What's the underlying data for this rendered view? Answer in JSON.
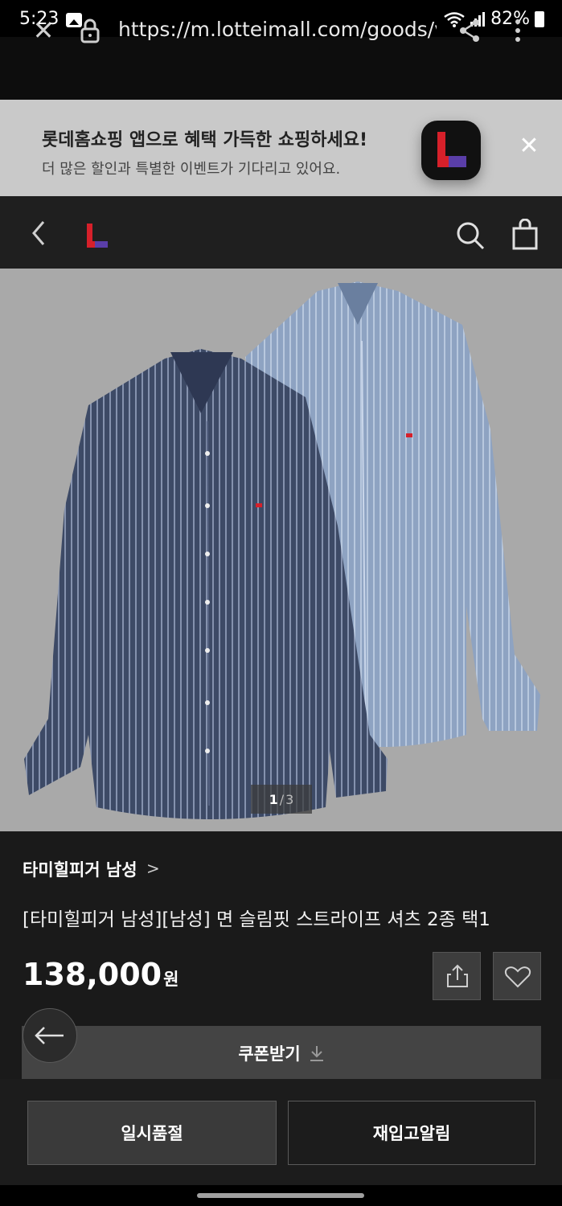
{
  "status_bar": {
    "time": "5:23",
    "battery": "82%"
  },
  "browser": {
    "url": "https://m.lotteimall.com/goods/viewGoodsDetail.lotte"
  },
  "app_banner": {
    "title": "롯데홈쇼핑 앱으로 혜택 가득한 쇼핑하세요!",
    "subtitle": "더 많은 할인과 특별한 이벤트가 기다리고 있어요."
  },
  "gallery": {
    "current": "1",
    "separator": "/",
    "total": "3"
  },
  "product": {
    "brand": "타미힐피거 남성",
    "brand_chevron": ">",
    "title": "[타미힐피거 남성][남성] 면 슬림핏 스트라이프 셔츠 2종 택1",
    "price": "138,000",
    "price_unit": "원"
  },
  "actions": {
    "coupon": "쿠폰받기",
    "soldout": "일시품절",
    "restock": "재입고알림"
  },
  "colors": {
    "accent_red": "#d6202a",
    "accent_purple": "#5a3ea8",
    "dark_shirt": "#3d4a66",
    "light_shirt": "#8ea3c2"
  }
}
